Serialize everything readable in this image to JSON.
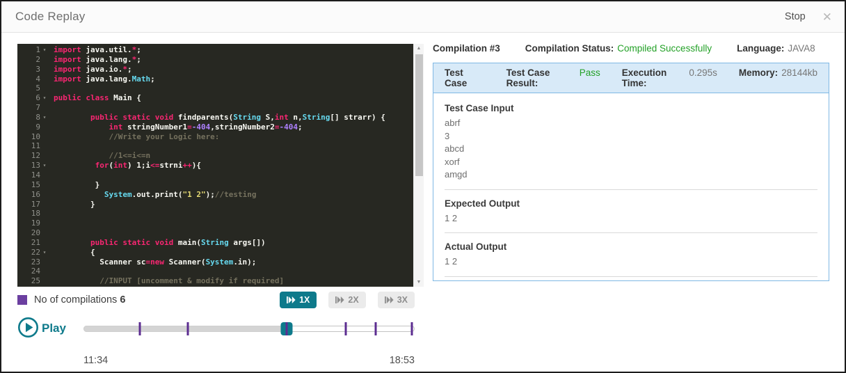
{
  "window": {
    "title": "Code Replay",
    "stop_label": "Stop",
    "close_icon": "✕"
  },
  "colors": {
    "accent_teal": "#0e7a8b",
    "legend_purple": "#6b3fa0",
    "marker_purple": "#5c2d91",
    "status_green": "#23a127",
    "editor_background": "#272822",
    "panel_border_blue": "#7fb8e4",
    "panel_header_blue": "#d8eaf8"
  },
  "editor": {
    "lines": [
      {
        "n": 1,
        "fold": true,
        "tokens": [
          [
            "k",
            "import"
          ],
          [
            "p",
            " java.util."
          ],
          [
            "k",
            "*"
          ],
          [
            "p",
            ";"
          ]
        ]
      },
      {
        "n": 2,
        "fold": false,
        "tokens": [
          [
            "k",
            "import"
          ],
          [
            "p",
            " java.lang."
          ],
          [
            "k",
            "*"
          ],
          [
            "p",
            ";"
          ]
        ]
      },
      {
        "n": 3,
        "fold": false,
        "tokens": [
          [
            "k",
            "import"
          ],
          [
            "p",
            " java.io."
          ],
          [
            "k",
            "*"
          ],
          [
            "p",
            ";"
          ]
        ]
      },
      {
        "n": 4,
        "fold": false,
        "tokens": [
          [
            "k",
            "import"
          ],
          [
            "p",
            " java.lang."
          ],
          [
            "t",
            "Math"
          ],
          [
            "p",
            ";"
          ]
        ]
      },
      {
        "n": 5,
        "fold": false,
        "tokens": []
      },
      {
        "n": 6,
        "fold": true,
        "tokens": [
          [
            "k",
            "public"
          ],
          [
            "p",
            " "
          ],
          [
            "k",
            "class"
          ],
          [
            "p",
            " Main {"
          ]
        ]
      },
      {
        "n": 7,
        "fold": false,
        "tokens": []
      },
      {
        "n": 8,
        "fold": true,
        "tokens": [
          [
            "p",
            "        "
          ],
          [
            "k",
            "public static void"
          ],
          [
            "p",
            " findparents("
          ],
          [
            "t",
            "String"
          ],
          [
            "p",
            " S,"
          ],
          [
            "k",
            "int"
          ],
          [
            "p",
            " n,"
          ],
          [
            "t",
            "String"
          ],
          [
            "p",
            "[] strarr) {"
          ]
        ]
      },
      {
        "n": 9,
        "fold": false,
        "tokens": [
          [
            "p",
            "            "
          ],
          [
            "k",
            "int"
          ],
          [
            "p",
            " stringNumber1"
          ],
          [
            "k",
            "="
          ],
          [
            "n",
            "-404"
          ],
          [
            "p",
            ",stringNumber2"
          ],
          [
            "k",
            "="
          ],
          [
            "n",
            "-404"
          ],
          [
            "p",
            ";"
          ]
        ]
      },
      {
        "n": 10,
        "fold": false,
        "tokens": [
          [
            "p",
            "            "
          ],
          [
            "c",
            "//Write your Logic here:"
          ]
        ]
      },
      {
        "n": 11,
        "fold": false,
        "tokens": []
      },
      {
        "n": 12,
        "fold": false,
        "tokens": [
          [
            "p",
            "            "
          ],
          [
            "c",
            "//1<=i<=n"
          ]
        ]
      },
      {
        "n": 13,
        "fold": true,
        "tokens": [
          [
            "p",
            "         "
          ],
          [
            "k",
            "for"
          ],
          [
            "p",
            "("
          ],
          [
            "k",
            "int"
          ],
          [
            "p",
            ") 1;i"
          ],
          [
            "k",
            "<="
          ],
          [
            "p",
            "strni"
          ],
          [
            "k",
            "++"
          ],
          [
            "p",
            "){"
          ]
        ]
      },
      {
        "n": 14,
        "fold": false,
        "tokens": []
      },
      {
        "n": 15,
        "fold": false,
        "tokens": [
          [
            "p",
            "         }"
          ]
        ]
      },
      {
        "n": 16,
        "fold": false,
        "tokens": [
          [
            "p",
            "           "
          ],
          [
            "t",
            "System"
          ],
          [
            "p",
            ".out.print("
          ],
          [
            "s",
            "\"1 2\""
          ],
          [
            "p",
            ");"
          ],
          [
            "c",
            "//testing"
          ]
        ]
      },
      {
        "n": 17,
        "fold": false,
        "tokens": [
          [
            "p",
            "        }"
          ]
        ]
      },
      {
        "n": 18,
        "fold": false,
        "tokens": []
      },
      {
        "n": 19,
        "fold": false,
        "tokens": []
      },
      {
        "n": 20,
        "fold": false,
        "tokens": []
      },
      {
        "n": 21,
        "fold": false,
        "tokens": [
          [
            "p",
            "        "
          ],
          [
            "k",
            "public static void"
          ],
          [
            "p",
            " main("
          ],
          [
            "t",
            "String"
          ],
          [
            "p",
            " args[])"
          ]
        ]
      },
      {
        "n": 22,
        "fold": true,
        "tokens": [
          [
            "p",
            "        {"
          ]
        ]
      },
      {
        "n": 23,
        "fold": false,
        "tokens": [
          [
            "p",
            "          Scanner sc"
          ],
          [
            "k",
            "=new"
          ],
          [
            "p",
            " Scanner("
          ],
          [
            "t",
            "System"
          ],
          [
            "p",
            ".in);"
          ]
        ]
      },
      {
        "n": 24,
        "fold": false,
        "tokens": []
      },
      {
        "n": 25,
        "fold": false,
        "tokens": [
          [
            "p",
            "          "
          ],
          [
            "c",
            "//INPUT [uncomment & modify if required]"
          ]
        ]
      }
    ]
  },
  "controls": {
    "legend_label": "No of compilations",
    "legend_count": "6",
    "speeds": [
      {
        "label": "1X",
        "active": true
      },
      {
        "label": "2X",
        "active": false
      },
      {
        "label": "3X",
        "active": false
      }
    ]
  },
  "player": {
    "play_label": "Play",
    "start_time": "11:34",
    "end_time": "18:53",
    "progress_pct": 61.3,
    "ticks_pct": [
      17,
      31.5,
      61.3,
      79.2,
      88.2,
      99.2
    ]
  },
  "compilation": {
    "title": "Compilation #3",
    "status_label": "Compilation Status:",
    "status_value": "Compiled Successfully",
    "language_label": "Language:",
    "language_value": "JAVA8"
  },
  "test_case": {
    "header": {
      "title": "Test Case",
      "result_label": "Test Case Result:",
      "result_value": "Pass",
      "time_label": "Execution Time:",
      "time_value": "0.295s",
      "memory_label": "Memory:",
      "memory_value": "28144kb"
    },
    "input_title": "Test Case Input",
    "input_lines": [
      "abrf",
      "3",
      "abcd",
      "xorf",
      "amgd"
    ],
    "expected_title": "Expected Output",
    "expected_value": "1 2",
    "actual_title": "Actual Output",
    "actual_value": "1 2"
  }
}
